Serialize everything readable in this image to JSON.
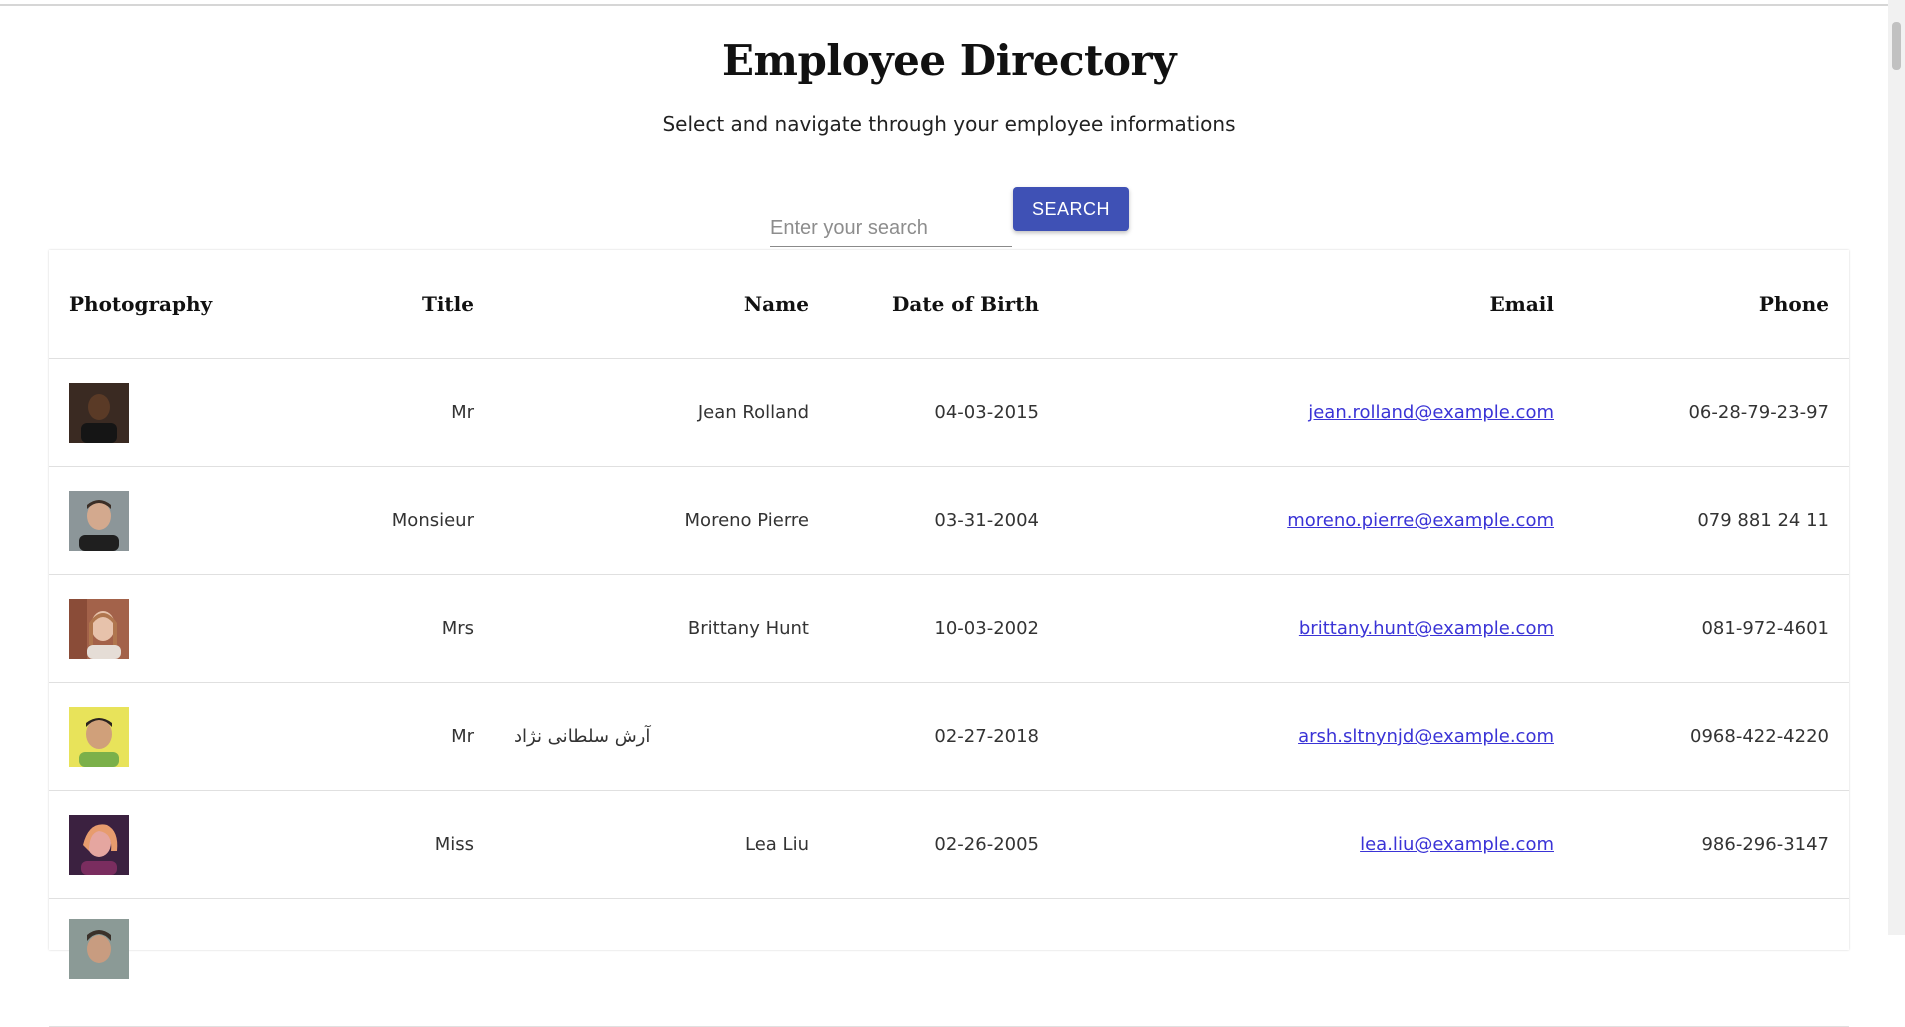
{
  "header": {
    "title": "Employee Directory",
    "subtitle": "Select and navigate through your employee informations"
  },
  "search": {
    "placeholder": "Enter your search",
    "value": "",
    "button_label": "SEARCH"
  },
  "table": {
    "columns": [
      "Photography",
      "Title",
      "Name",
      "Date of Birth",
      "Email",
      "Phone"
    ],
    "rows": [
      {
        "title": "Mr",
        "name": "Jean Rolland",
        "dob": "04-03-2015",
        "email": "jean.rolland@example.com",
        "phone": "06-28-79-23-97"
      },
      {
        "title": "Monsieur",
        "name": "Moreno Pierre",
        "dob": "03-31-2004",
        "email": "moreno.pierre@example.com",
        "phone": "079 881 24 11"
      },
      {
        "title": "Mrs",
        "name": "Brittany Hunt",
        "dob": "10-03-2002",
        "email": "brittany.hunt@example.com",
        "phone": "081-972-4601"
      },
      {
        "title": "Mr",
        "name": "آرش سلطانی نژاد",
        "dob": "02-27-2018",
        "email": "arsh.sltnynjd@example.com",
        "phone": "0968-422-4220"
      },
      {
        "title": "Miss",
        "name": "Lea Liu",
        "dob": "02-26-2005",
        "email": "lea.liu@example.com",
        "phone": "986-296-3147"
      },
      {
        "title": "",
        "name": "",
        "dob": "",
        "email": "",
        "phone": ""
      }
    ]
  },
  "colors": {
    "accent": "#3f51b5",
    "link": "#3a33d6"
  }
}
